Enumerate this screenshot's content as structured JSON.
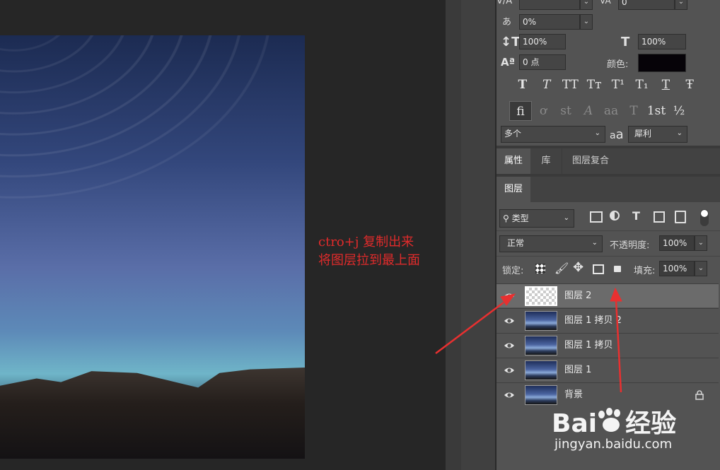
{
  "annotation": {
    "line1": "ctro+j 复制出来",
    "line2": "将图层拉到最上面"
  },
  "character_panel": {
    "tracking_value": "0",
    "scale_pct": "0%",
    "vertical_scale": "100%",
    "horizontal_scale": "100%",
    "baseline_shift": "0 点",
    "color_label": "颜色:",
    "color_value": "#060308",
    "language": "多个",
    "antialias_label": "a",
    "antialias_label2": "a",
    "antialias": "犀利"
  },
  "typo_buttons": [
    "T",
    "T",
    "TT",
    "Tт",
    "T¹",
    "T₁",
    "T",
    "Ŧ"
  ],
  "opentype_buttons": [
    "fi",
    "ơ",
    "st",
    "A",
    "aa",
    "T",
    "1st",
    "½"
  ],
  "tabs_top": [
    "属性",
    "库",
    "图层复合"
  ],
  "layers_tab": "图层",
  "filter": {
    "kind": "类型"
  },
  "blend": {
    "mode": "正常",
    "opacity_label": "不透明度:",
    "opacity": "100%"
  },
  "lock": {
    "label": "锁定:",
    "fill_label": "填充:",
    "fill": "100%"
  },
  "layers": [
    {
      "name": "图层 2",
      "selected": true,
      "transparent": true
    },
    {
      "name": "图层 1 拷贝 2",
      "selected": false,
      "transparent": false
    },
    {
      "name": "图层 1 拷贝",
      "selected": false,
      "transparent": false
    },
    {
      "name": "图层 1",
      "selected": false,
      "transparent": false
    },
    {
      "name": "背景",
      "selected": false,
      "transparent": false,
      "locked": true
    }
  ],
  "watermark": {
    "brand_a": "Bai",
    "brand_b": "经验",
    "url": "jingyan.baidu.com"
  },
  "colors": {
    "annotation_red": "#e12b2b",
    "panel_bg": "#535353",
    "selected_row": "#6b6b6b"
  }
}
